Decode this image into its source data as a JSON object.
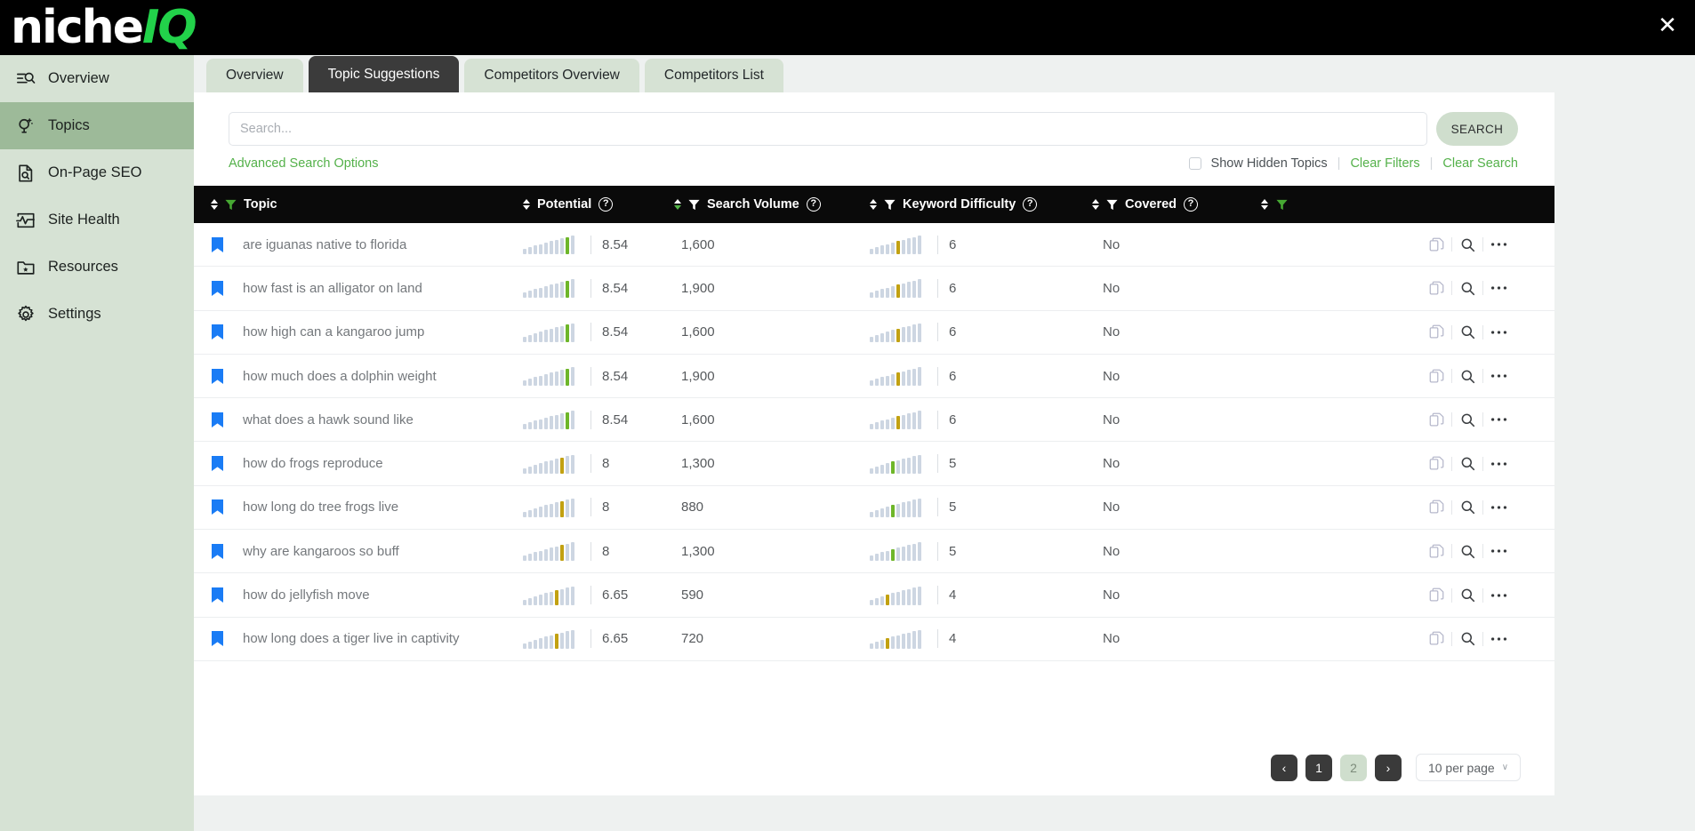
{
  "brand": {
    "name_white": "niche",
    "name_green": "IQ"
  },
  "window": {
    "close_label": "✕"
  },
  "sidebar": {
    "items": [
      {
        "label": "Overview",
        "icon": "overview-icon",
        "active": false
      },
      {
        "label": "Topics",
        "icon": "lightbulb-icon",
        "active": true
      },
      {
        "label": "On-Page SEO",
        "icon": "page-search-icon",
        "active": false
      },
      {
        "label": "Site Health",
        "icon": "pulse-icon",
        "active": false
      },
      {
        "label": "Resources",
        "icon": "folder-star-icon",
        "active": false
      },
      {
        "label": "Settings",
        "icon": "gear-icon",
        "active": false
      }
    ]
  },
  "tabs": [
    {
      "label": "Overview",
      "active": false
    },
    {
      "label": "Topic Suggestions",
      "active": true
    },
    {
      "label": "Competitors Overview",
      "active": false
    },
    {
      "label": "Competitors List",
      "active": false
    }
  ],
  "search": {
    "value": "",
    "placeholder": "Search...",
    "button_label": "SEARCH"
  },
  "subrow": {
    "advanced_label": "Advanced Search Options",
    "show_hidden_label": "Show Hidden Topics",
    "show_hidden_checked": false,
    "clear_filters_label": "Clear Filters",
    "clear_search_label": "Clear Search",
    "separator": "|"
  },
  "table": {
    "columns": [
      {
        "key": "topic",
        "label": "Topic",
        "has_help": false,
        "has_filter": true,
        "filter_active": true,
        "has_sort": true
      },
      {
        "key": "potential",
        "label": "Potential",
        "has_help": true,
        "has_filter": false,
        "filter_active": false,
        "has_sort": true
      },
      {
        "key": "volume",
        "label": "Search Volume",
        "has_help": true,
        "has_filter": true,
        "filter_active": false,
        "has_sort": true
      },
      {
        "key": "kd",
        "label": "Keyword Difficulty",
        "has_help": true,
        "has_filter": true,
        "filter_active": false,
        "has_sort": true
      },
      {
        "key": "covered",
        "label": "Covered",
        "has_help": true,
        "has_filter": true,
        "filter_active": false,
        "has_sort": true
      }
    ],
    "actions_filter_active": true,
    "rows": [
      {
        "topic": "are iguanas native to florida",
        "potential": "8.54",
        "potential_level": 9,
        "potential_color": "green",
        "volume": "1,600",
        "kd": "6",
        "kd_level": 6,
        "kd_color": "gold",
        "covered": "No"
      },
      {
        "topic": "how fast is an alligator on land",
        "potential": "8.54",
        "potential_level": 9,
        "potential_color": "green",
        "volume": "1,900",
        "kd": "6",
        "kd_level": 6,
        "kd_color": "gold",
        "covered": "No"
      },
      {
        "topic": "how high can a kangaroo jump",
        "potential": "8.54",
        "potential_level": 9,
        "potential_color": "green",
        "volume": "1,600",
        "kd": "6",
        "kd_level": 6,
        "kd_color": "gold",
        "covered": "No"
      },
      {
        "topic": "how much does a dolphin weight",
        "potential": "8.54",
        "potential_level": 9,
        "potential_color": "green",
        "volume": "1,900",
        "kd": "6",
        "kd_level": 6,
        "kd_color": "gold",
        "covered": "No"
      },
      {
        "topic": "what does a hawk sound like",
        "potential": "8.54",
        "potential_level": 9,
        "potential_color": "green",
        "volume": "1,600",
        "kd": "6",
        "kd_level": 6,
        "kd_color": "gold",
        "covered": "No"
      },
      {
        "topic": "how do frogs reproduce",
        "potential": "8",
        "potential_level": 8,
        "potential_color": "gold",
        "volume": "1,300",
        "kd": "5",
        "kd_level": 5,
        "kd_color": "green",
        "covered": "No"
      },
      {
        "topic": "how long do tree frogs live",
        "potential": "8",
        "potential_level": 8,
        "potential_color": "gold",
        "volume": "880",
        "kd": "5",
        "kd_level": 5,
        "kd_color": "green",
        "covered": "No"
      },
      {
        "topic": "why are kangaroos so buff",
        "potential": "8",
        "potential_level": 8,
        "potential_color": "gold",
        "volume": "1,300",
        "kd": "5",
        "kd_level": 5,
        "kd_color": "green",
        "covered": "No"
      },
      {
        "topic": "how do jellyfish move",
        "potential": "6.65",
        "potential_level": 7,
        "potential_color": "gold",
        "volume": "590",
        "kd": "4",
        "kd_level": 4,
        "kd_color": "gold",
        "covered": "No"
      },
      {
        "topic": "how long does a tiger live in captivity",
        "potential": "6.65",
        "potential_level": 7,
        "potential_color": "gold",
        "volume": "720",
        "kd": "4",
        "kd_level": 4,
        "kd_color": "gold",
        "covered": "No"
      }
    ],
    "row_actions": [
      {
        "name": "copy-icon",
        "label": "Copy"
      },
      {
        "name": "search-icon",
        "label": "Inspect"
      },
      {
        "name": "more-icon",
        "label": "More"
      }
    ]
  },
  "pagination": {
    "prev_label": "‹",
    "next_label": "›",
    "pages": [
      {
        "label": "1",
        "active": true
      },
      {
        "label": "2",
        "active": false
      }
    ],
    "per_page_label": "10 per page",
    "caret": "∨"
  },
  "colors": {
    "brand_green": "#22d24a",
    "accent_green": "#54b14a",
    "sidebar_bg": "#d6e2d4",
    "sidebar_active": "#9dba99",
    "header_bg": "#0a0a0a",
    "bar_green": "#6eb62a",
    "bar_gold": "#c2a112",
    "bar_idle": "#cdd6e2",
    "bookmark_blue": "#1a7cf5"
  }
}
